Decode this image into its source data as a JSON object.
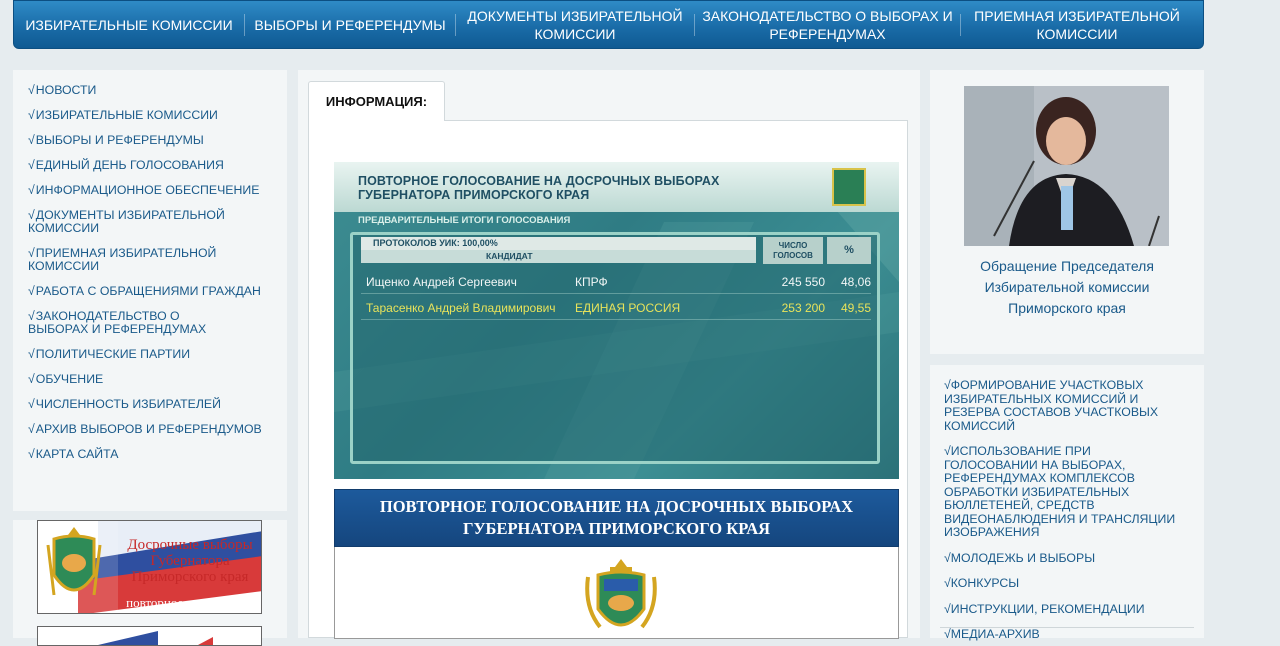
{
  "topnav": {
    "items": [
      {
        "label": "ИЗБИРАТЕЛЬНЫЕ КОМИССИИ"
      },
      {
        "label": "ВЫБОРЫ И РЕФЕРЕНДУМЫ"
      },
      {
        "label": "ДОКУМЕНТЫ ИЗБИРАТЕЛЬНОЙ КОМИССИИ"
      },
      {
        "label": "ЗАКОНОДАТЕЛЬСТВО О ВЫБОРАХ И РЕФЕРЕНДУМАХ"
      },
      {
        "label": "ПРИЕМНАЯ ИЗБИРАТЕЛЬНОЙ КОМИССИИ"
      }
    ]
  },
  "sidebar_left": {
    "check": "√",
    "items": [
      {
        "label": "НОВОСТИ"
      },
      {
        "label": "ИЗБИРАТЕЛЬНЫЕ КОМИССИИ"
      },
      {
        "label": "ВЫБОРЫ И РЕФЕРЕНДУМЫ"
      },
      {
        "label": "ЕДИНЫЙ ДЕНЬ ГОЛОСОВАНИЯ"
      },
      {
        "label": "ИНФОРМАЦИОННОЕ ОБЕСПЕЧЕНИЕ"
      },
      {
        "label": "ДОКУМЕНТЫ ИЗБИРАТЕЛЬНОЙ КОМИССИИ"
      },
      {
        "label": "ПРИЕМНАЯ ИЗБИРАТЕЛЬНОЙ КОМИССИИ"
      },
      {
        "label": "РАБОТА С ОБРАЩЕНИЯМИ ГРАЖДАН"
      },
      {
        "label": "ЗАКОНОДАТЕЛЬСТВО О ВЫБОРАХ И РЕФЕРЕНДУМАХ"
      },
      {
        "label": "ПОЛИТИЧЕСКИЕ ПАРТИИ"
      },
      {
        "label": "ОБУЧЕНИЕ"
      },
      {
        "label": "ЧИСЛЕННОСТЬ ИЗБИРАТЕЛЕЙ"
      },
      {
        "label": "АРХИВ ВЫБОРОВ И РЕФЕРЕНДУМОВ"
      },
      {
        "label": "КАРТА САЙТА"
      }
    ],
    "banner": {
      "line1": "Досрочные выборы",
      "line2": "Губернатора",
      "line3": "Приморского края",
      "line4": "повторное голосование"
    }
  },
  "main": {
    "tab_label": "ИНФОРМАЦИЯ:",
    "tv": {
      "title_line1": "ПОВТОРНОЕ ГОЛОСОВАНИЕ НА ДОСРОЧНЫХ ВЫБОРАХ",
      "title_line2": "ГУБЕРНАТОРА ПРИМОРСКОГО КРАЯ",
      "subtitle": "ПРЕДВАРИТЕЛЬНЫЕ ИТОГИ ГОЛОСОВАНИЯ",
      "protocols": "ПРОТОКОЛОВ УИК:  100,00%",
      "col_candidate": "КАНДИДАТ",
      "col_votes": "ЧИСЛО ГОЛОСОВ",
      "col_pct": "%",
      "rows": [
        {
          "candidate": "Ищенко Андрей Сергеевич",
          "party": "КПРФ",
          "votes": "245 550",
          "pct": "48,06"
        },
        {
          "candidate": "Тарасенко Андрей Владимирович",
          "party": "ЕДИНАЯ РОССИЯ",
          "votes": "253 200",
          "pct": "49,55"
        }
      ]
    },
    "announce": {
      "line1": "ПОВТОРНОЕ ГОЛОСОВАНИЕ НА ДОСРОЧНЫХ ВЫБОРАХ",
      "line2": "ГУБЕРНАТОРА ПРИМОРСКОГО КРАЯ"
    }
  },
  "sidebar_right": {
    "appeal": {
      "line1": "Обращение Председателя",
      "line2": "Избирательной комиссии",
      "line3": "Приморского края"
    },
    "check": "√",
    "items": [
      {
        "label": "ФОРМИРОВАНИЕ УЧАСТКОВЫХ ИЗБИРАТЕЛЬНЫХ КОМИССИЙ И РЕЗЕРВА СОСТАВОВ УЧАСТКОВЫХ КОМИССИЙ"
      },
      {
        "label": "ИСПОЛЬЗОВАНИЕ ПРИ ГОЛОСОВАНИИ НА ВЫБОРАХ, РЕФЕРЕНДУМАХ КОМПЛЕКСОВ ОБРАБОТКИ ИЗБИРАТЕЛЬНЫХ БЮЛЛЕТЕНЕЙ, СРЕДСТВ ВИДЕОНАБЛЮДЕНИЯ И ТРАНСЛЯЦИИ ИЗОБРАЖЕНИЯ"
      },
      {
        "label": "МОЛОДЕЖЬ И ВЫБОРЫ"
      },
      {
        "label": "КОНКУРСЫ"
      },
      {
        "label": "ИНСТРУКЦИИ, РЕКОМЕНДАЦИИ"
      },
      {
        "label": "МЕДИА-АРХИВ"
      }
    ]
  },
  "colors": {
    "nav_blue": "#1a6ca8",
    "link_blue": "#1a5a8a",
    "tv_teal": "#2f7c84",
    "highlight_yellow": "#e8e35a"
  }
}
